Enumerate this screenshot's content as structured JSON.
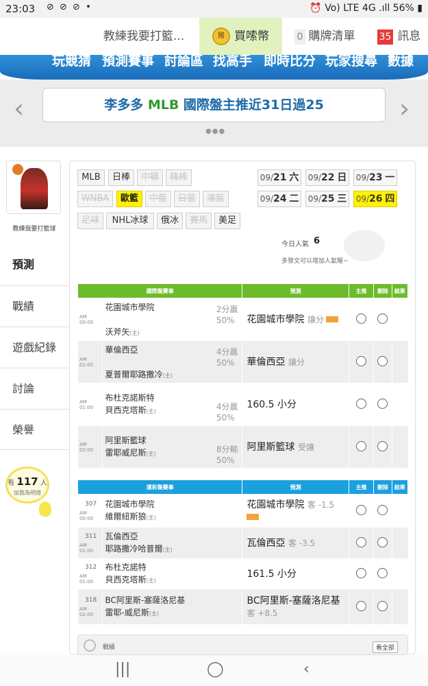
{
  "status": {
    "time": "23:03",
    "notif_icons": "⊘ ⊘ ⊘ •",
    "right_icons": "⏰ Vo) LTE 4G .ıll",
    "battery": "56%"
  },
  "topnav": {
    "user_tab": "教練我要打籃...",
    "coin_tab": "買嗦幣",
    "coin_icon_text": "賭",
    "cart_count": "0",
    "cart_label": "購牌清單",
    "msg_count": "35",
    "msg_label": "訊息"
  },
  "menu": [
    "玩競猜",
    "預測賽事",
    "討論區",
    "找高手",
    "即時比分",
    "玩家搜尋",
    "數據"
  ],
  "banner": {
    "text_pre": "李多多 ",
    "text_mlb": "MLB",
    "text_post": " 國際盤主推近31日過25",
    "prev": "‹",
    "next": "›",
    "dots": "●●●"
  },
  "sidebar": {
    "username": "教練我要打籃球",
    "items": [
      "預測",
      "戰績",
      "遊戲紀錄",
      "討論",
      "榮譽"
    ],
    "fans_pre": "有",
    "fans_count": "117",
    "fans_post": "人",
    "fans_hint": "加我為明燈"
  },
  "leagues": [
    {
      "label": "MLB",
      "state": "normal"
    },
    {
      "label": "日棒",
      "state": "normal"
    },
    {
      "label": "中職",
      "state": "disabled"
    },
    {
      "label": "韓棒",
      "state": "disabled"
    },
    {
      "label": "WNBA",
      "state": "disabled"
    },
    {
      "label": "歐籃",
      "state": "selected"
    },
    {
      "label": "中籃",
      "state": "disabled"
    },
    {
      "label": "日籃",
      "state": "disabled"
    },
    {
      "label": "澳籃",
      "state": "disabled"
    },
    {
      "label": "足球",
      "state": "disabled"
    },
    {
      "label": "NHL冰球",
      "state": "normal"
    },
    {
      "label": "俄冰",
      "state": "normal"
    },
    {
      "label": "賽馬",
      "state": "disabled"
    },
    {
      "label": "美足",
      "state": "normal"
    }
  ],
  "dates": [
    {
      "md": "09/",
      "d": "21",
      "w": "六",
      "sel": false
    },
    {
      "md": "09/",
      "d": "22",
      "w": "日",
      "sel": false
    },
    {
      "md": "09/",
      "d": "23",
      "w": "一",
      "sel": false
    },
    {
      "md": "09/",
      "d": "24",
      "w": "二",
      "sel": false
    },
    {
      "md": "09/",
      "d": "25",
      "w": "三",
      "sel": false
    },
    {
      "md": "09/",
      "d": "26",
      "w": "四",
      "sel": true
    }
  ],
  "popularity": {
    "label": "今日人氣",
    "value": "6",
    "hint": "多發文可以增加人氣喔~"
  },
  "intl_table": {
    "color": "#6cbb2a",
    "headers": [
      "國際盤賽事",
      "預測",
      "主推",
      "刪除",
      "結果"
    ],
    "rows": [
      {
        "time": "AM 00:00",
        "num": "",
        "team1": "花園城市學院",
        "team2": "沃斧矢",
        "home": "(主)",
        "odds1": "2分贏",
        "odds2": "50%",
        "pick": "花園城市學院",
        "pick_sub": "讓分",
        "tag": true
      },
      {
        "time": "AM 01:00",
        "num": "",
        "team1": "華倫西亞",
        "team2": "夏普爾耶路撒冷",
        "home": "(主)",
        "odds1": "4分贏",
        "odds2": "50%",
        "pick": "華倫西亞",
        "pick_sub": "讓分",
        "tag": false
      },
      {
        "time": "AM 01:00",
        "num": "",
        "team1": "布杜克諾斯特",
        "team2": "貝西克塔斯",
        "home": "(主)",
        "odds1": "4分贏",
        "odds2": "50%",
        "pick": "160.5 小分",
        "pick_sub": "",
        "tag": false
      },
      {
        "time": "AM 02:00",
        "num": "",
        "team1": "阿里斯籃球",
        "team2": "雷耶威尼斯",
        "home": "(主)",
        "odds1": "8分輸",
        "odds2": "50%",
        "pick": "阿里斯籃球",
        "pick_sub": "受讓",
        "tag": false
      }
    ]
  },
  "sport_table": {
    "color": "#1aa0de",
    "headers": [
      "運彩盤賽事",
      "預測",
      "主推",
      "刪除",
      "結果"
    ],
    "rows": [
      {
        "time": "AM 00:00",
        "num": "307",
        "team1": "花園城市學院",
        "team2": "維爾紐斯狼",
        "home": "(主)",
        "pick": "花園城市學院",
        "pick_sub": "客 -1.5",
        "tag": true
      },
      {
        "time": "AM 01:00",
        "num": "311",
        "team1": "瓦倫西亞",
        "team2": "耶路撒冷哈普爾",
        "home": "(主)",
        "pick": "瓦倫西亞",
        "pick_sub": "客 -3.5",
        "tag": false
      },
      {
        "time": "AM 01:00",
        "num": "312",
        "team1": "布杜克諾特",
        "team2": "貝西克塔斯",
        "home": "(主)",
        "pick": "161.5 小分",
        "pick_sub": "",
        "tag": false
      },
      {
        "time": "AM 02:00",
        "num": "318",
        "team1": "BC阿里斯-塞薩洛尼基",
        "team2": "雷耶-威尼斯",
        "home": "(主)",
        "pick": "BC阿里斯-塞薩洛尼基",
        "pick_sub": "客 +8.5",
        "tag": false
      }
    ]
  },
  "footer_bar": {
    "label": "戰績",
    "more": "看全部"
  },
  "navbar": {
    "recent": "|||",
    "home": "◯",
    "back": "‹"
  }
}
